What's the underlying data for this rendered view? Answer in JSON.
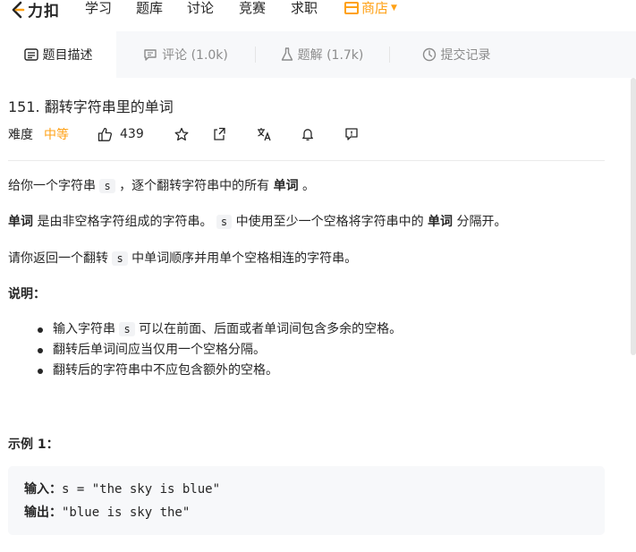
{
  "nav": {
    "logo_text": "力扣",
    "items": [
      "学习",
      "题库",
      "讨论",
      "竞赛",
      "求职"
    ],
    "shop_label": "商店",
    "shop_color": "#ffa116"
  },
  "tabs": [
    {
      "label": "题目描述",
      "icon": "description-icon",
      "active": true
    },
    {
      "label": "评论 (1.0k)",
      "icon": "comment-icon",
      "active": false
    },
    {
      "label": "题解 (1.7k)",
      "icon": "flask-icon",
      "active": false
    },
    {
      "label": "提交记录",
      "icon": "clock-icon",
      "active": false
    }
  ],
  "problem": {
    "title": "151. 翻转字符串里的单词",
    "difficulty_label": "难度",
    "difficulty": "中等",
    "difficulty_color": "#ffa116",
    "likes": "439"
  },
  "description": {
    "p1": {
      "a": "给你一个字符串",
      "code": "s",
      "b": "，逐个翻转字符串中的所有",
      "bold": "单词",
      "c": "。"
    },
    "p2": {
      "bold1": "单词",
      "a": "是由非空格字符组成的字符串。",
      "code": "s",
      "b": "中使用至少一个空格将字符串中的",
      "bold2": "单词",
      "c": "分隔开。"
    },
    "p3": {
      "a": "请你返回一个翻转",
      "code": "s",
      "b": "中单词顺序并用单个空格相连的字符串。"
    },
    "notes_title": "说明：",
    "notes": [
      {
        "a": "输入字符串",
        "code": "s",
        "b": "可以在前面、后面或者单词间包含多余的空格。"
      },
      {
        "a": "翻转后单词间应当仅用一个空格分隔。"
      },
      {
        "a": "翻转后的字符串中不应包含额外的空格。"
      }
    ]
  },
  "example": {
    "title": "示例 1：",
    "input_label": "输入：",
    "input_value": "s = \"the sky is blue\"",
    "output_label": "输出：",
    "output_value": "\"blue is sky the\""
  }
}
